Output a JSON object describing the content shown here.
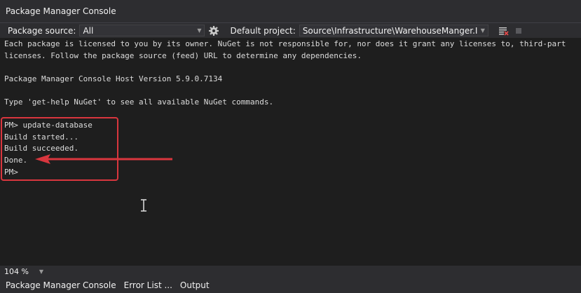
{
  "window": {
    "title": "Package Manager Console"
  },
  "toolbar": {
    "package_source_label": "Package source:",
    "package_source_value": "All",
    "default_project_label": "Default project:",
    "default_project_value": "Source\\Infrastructure\\WarehouseManger.Infrast"
  },
  "console": {
    "lines": [
      "Each package is licensed to you by its owner. NuGet is not responsible for, nor does it grant any licenses to, third-part",
      "licenses. Follow the package source (feed) URL to determine any dependencies.",
      "Package Manager Console Host Version 5.9.0.7134",
      "Type 'get-help NuGet' to see all available NuGet commands.",
      "PM> update-database",
      "Build started...",
      "Build succeeded.",
      "Done.",
      "PM>"
    ]
  },
  "zoom": {
    "value": "104 %"
  },
  "bottom_tabs": [
    "Package Manager Console",
    "Error List ...",
    "Output"
  ],
  "colors": {
    "highlight": "#d9363e",
    "background": "#1e1e1e",
    "toolbar": "#2d2d30"
  }
}
